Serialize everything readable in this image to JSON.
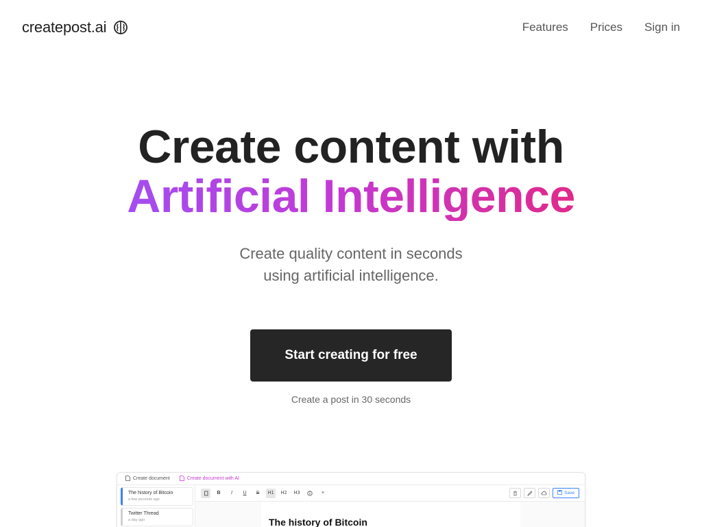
{
  "header": {
    "logo_text": "createpost.ai",
    "logo_icon": "brain-icon",
    "nav": [
      {
        "label": "Features"
      },
      {
        "label": "Prices"
      },
      {
        "label": "Sign in"
      }
    ]
  },
  "hero": {
    "title_line1": "Create content with",
    "title_line2": "Artificial Intelligence",
    "gradient": [
      "#a34df0",
      "#c23ad6",
      "#e02a8a"
    ],
    "subtitle_line1": "Create quality content in seconds",
    "subtitle_line2": "using artificial intelligence.",
    "cta_label": "Start creating for free",
    "cta_caption": "Create a post in 30 seconds"
  },
  "preview": {
    "tabs": [
      {
        "label": "Create document",
        "icon": "document-icon"
      },
      {
        "label": "Create document with AI",
        "icon": "ai-document-icon"
      }
    ],
    "documents": [
      {
        "title": "The history of Bitcoin",
        "time": "a few seconds ago"
      },
      {
        "title": "Twitter Thread",
        "time": "a day ago"
      }
    ],
    "toolbar": {
      "bold": "B",
      "italic": "I",
      "underline": "U",
      "strike": "S",
      "h1": "H1",
      "h2": "H2",
      "h3": "H3",
      "clear": "×",
      "save": "Save"
    },
    "editor_title": "The history of Bitcoin",
    "accent": "#3b82f6"
  }
}
